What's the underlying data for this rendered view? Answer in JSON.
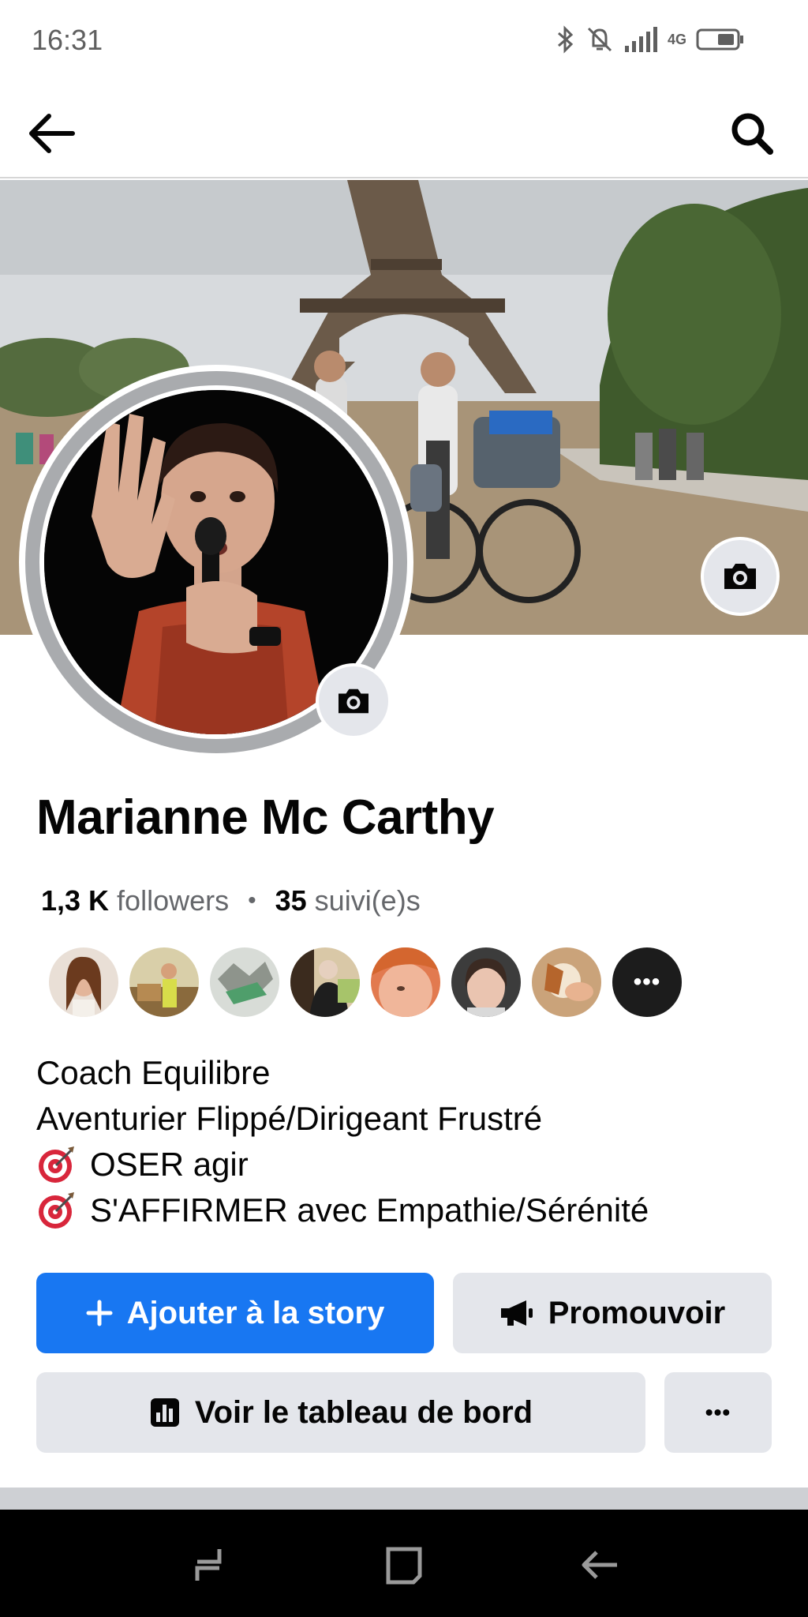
{
  "status_bar": {
    "time": "16:31",
    "network": "4G",
    "icons": [
      "bluetooth-icon",
      "bell-off-icon",
      "signal-icon",
      "battery-icon"
    ]
  },
  "header": {
    "back_icon": "arrow-left-icon",
    "search_icon": "search-icon"
  },
  "cover": {
    "camera_icon": "camera-icon"
  },
  "profile": {
    "name": "Marianne Mc Carthy",
    "followers_count": "1,3 K",
    "followers_label": "followers",
    "separator": "•",
    "following_count": "35",
    "following_label": "suivi(e)s"
  },
  "friends": {
    "more_label": "•••",
    "count_shown": 7
  },
  "bio": {
    "line1": "Coach Equilibre",
    "line2": "Aventurier Flippé/Dirigeant Frustré",
    "line3": "OSER agir",
    "line4": "S'AFFIRMER avec Empathie/Sérénité"
  },
  "actions": {
    "add_story_label": "Ajouter à la story",
    "promote_label": "Promouvoir",
    "dashboard_label": "Voir le tableau de bord",
    "more_label": "•••"
  },
  "colors": {
    "primary": "#1877f2",
    "secondary_button": "#e4e6eb",
    "muted_text": "#65676b"
  }
}
